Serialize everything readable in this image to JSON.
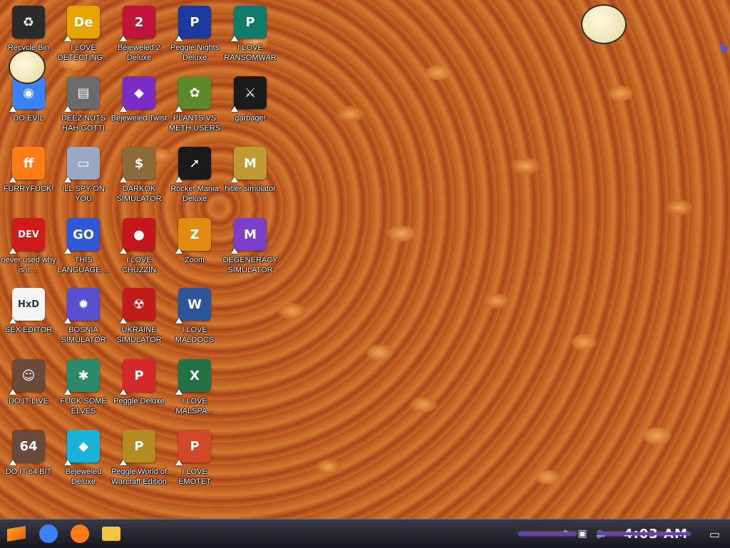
{
  "desktop": {
    "icons": [
      {
        "label": "Recycle Bin",
        "icon": "recycle-bin-icon",
        "color": "#2b2b2b",
        "symbol": "♻"
      },
      {
        "label": "I LOVE DETECTING...",
        "icon": "detect-it-easy-icon",
        "color": "#e6a400",
        "symbol": "De"
      },
      {
        "label": "Bejeweled 2 Deluxe",
        "icon": "bejeweled2-icon",
        "color": "#c0143a",
        "symbol": "2"
      },
      {
        "label": "Peggle Nights Deluxe",
        "icon": "peggle-nights-icon",
        "color": "#1a3a9e",
        "symbol": "P"
      },
      {
        "label": "I LOVE RANSOMWARE",
        "icon": "publisher-icon",
        "color": "#0f7b6a",
        "symbol": "P"
      },
      {
        "label": "DO EVIL",
        "icon": "chrome-icon",
        "color": "#3b82f6",
        "symbol": "◉"
      },
      {
        "label": "DEEZ NUTS HAH GOTTI",
        "icon": "windows-stack-icon",
        "color": "#6b6b6b",
        "symbol": "▤"
      },
      {
        "label": "Bejeweled Twist",
        "icon": "bejeweled-twist-icon",
        "color": "#7b2bc6",
        "symbol": "◆"
      },
      {
        "label": "PLANTS VS METH USERS",
        "icon": "plants-vs-zombies-icon",
        "color": "#5a8a2a",
        "symbol": "✿"
      },
      {
        "label": "garbage!",
        "icon": "aoe-icon",
        "color": "#1b1b1b",
        "symbol": "⚔"
      },
      {
        "label": "FURRYFUCK!",
        "icon": "firefox-icon",
        "color": "#ff7b16",
        "symbol": "ff"
      },
      {
        "label": "ILL SPY ON YOU",
        "icon": "remote-desktop-icon",
        "color": "#9aa8c4",
        "symbol": "▭"
      },
      {
        "label": "DARKOK SIMULATOR",
        "icon": "money-bag-icon",
        "color": "#8b6b3a",
        "symbol": "$"
      },
      {
        "label": "Rocket Mania Deluxe",
        "icon": "rocket-mania-icon",
        "color": "#1a1a1a",
        "symbol": "➚"
      },
      {
        "label": "hitler simulator",
        "icon": "medal-icon",
        "color": "#c09a30",
        "symbol": "M"
      },
      {
        "label": "never used why is it ...",
        "icon": "dev-cpp-icon",
        "color": "#d11b1b",
        "symbol": "DEV"
      },
      {
        "label": "THIS LANGUAGE ...",
        "icon": "goland-icon",
        "color": "#2e58d6",
        "symbol": "GO"
      },
      {
        "label": "I LOVE CHUZZIN",
        "icon": "chuzzle-icon",
        "color": "#c4161c",
        "symbol": "●"
      },
      {
        "label": "Zoom",
        "icon": "zuma-icon",
        "color": "#e08a10",
        "symbol": "Z"
      },
      {
        "label": "DEGENERACY SIMULATOR",
        "icon": "degeneracy-icon",
        "color": "#7a3ec9",
        "symbol": "M"
      },
      {
        "label": "SEX EDITOR",
        "icon": "hxd-icon",
        "color": "#f5f5f5",
        "symbol": "HxD"
      },
      {
        "label": "BOSNIA SIMULATOR",
        "icon": "spiked-ball-icon",
        "color": "#5a4fd0",
        "symbol": "✹"
      },
      {
        "label": "UKRAINE SIMULATOR",
        "icon": "radiation-icon",
        "color": "#c21b1b",
        "symbol": "☢"
      },
      {
        "label": "I LOVE MALDOCS",
        "icon": "word-icon",
        "color": "#2b579a",
        "symbol": "W"
      },
      {
        "label": "",
        "icon": "blank-icon",
        "color": "transparent",
        "symbol": ""
      },
      {
        "label": "DO IT LIVE",
        "icon": "portrait-icon",
        "color": "#6a4a3a",
        "symbol": "☺"
      },
      {
        "label": "FUCK SOME ELVES",
        "icon": "santa-icon",
        "color": "#2a8a6a",
        "symbol": "✱"
      },
      {
        "label": "Peggle Deluxe",
        "icon": "peggle-icon",
        "color": "#d4282a",
        "symbol": "P"
      },
      {
        "label": "I LOVE MALSPA...",
        "icon": "excel-icon",
        "color": "#217346",
        "symbol": "X"
      },
      {
        "label": "",
        "icon": "blank-icon",
        "color": "transparent",
        "symbol": ""
      },
      {
        "label": "DO IT 64 BIT",
        "icon": "portrait64-icon",
        "color": "#6a4a3a",
        "symbol": "64"
      },
      {
        "label": "Bejeweled Deluxe",
        "icon": "diamond-icon",
        "color": "#18b3d8",
        "symbol": "◆"
      },
      {
        "label": "Peggle World of Warcraft Edition",
        "icon": "peggle-wow-icon",
        "color": "#b58a20",
        "symbol": "P"
      },
      {
        "label": "I LOVE EMOTET",
        "icon": "powerpoint-icon",
        "color": "#d24726",
        "symbol": "P"
      }
    ]
  },
  "taskbar": {
    "start": {
      "icon": "start-orb-icon"
    },
    "apps": [
      {
        "icon": "chrome-taskbar-icon",
        "color": "#3b82f6"
      },
      {
        "icon": "firefox-taskbar-icon",
        "color": "#ff7b16"
      },
      {
        "icon": "file-explorer-icon",
        "color": "#f5c542"
      }
    ],
    "tray": {
      "chevron": "^",
      "network_icon": "network-icon",
      "volume_icon": "volume-icon",
      "clock": "4:03 AM",
      "notification_icon": "notification-icon"
    },
    "accent": "#6b3fb0"
  }
}
